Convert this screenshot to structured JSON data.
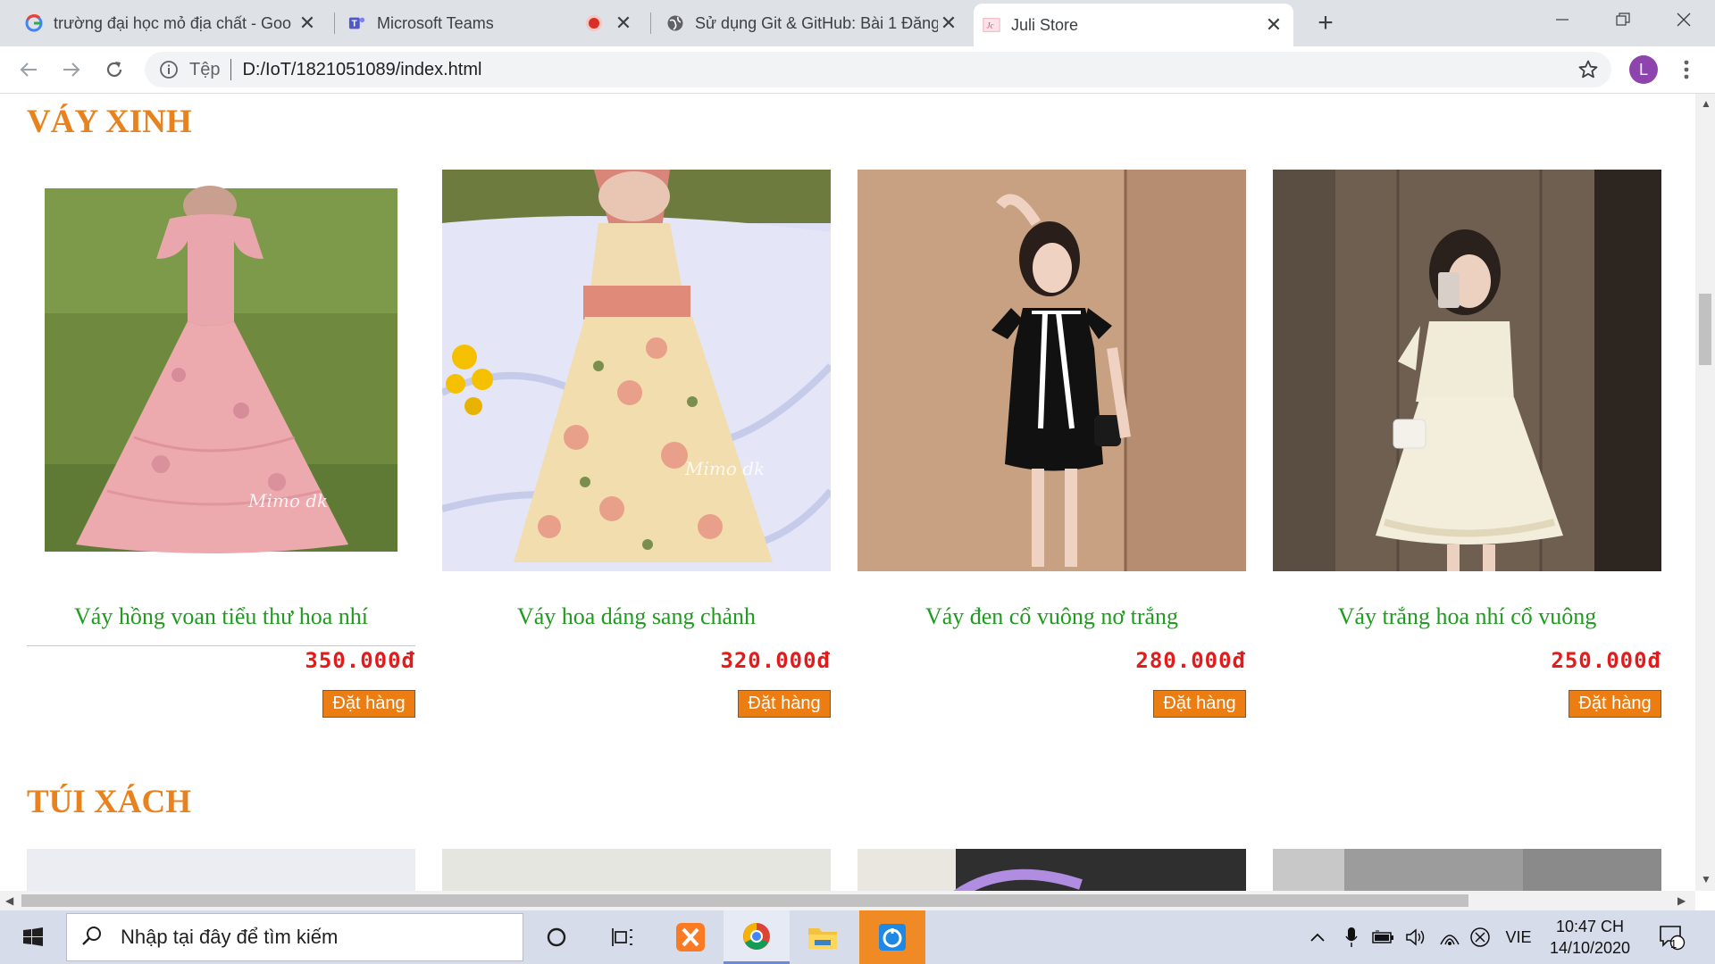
{
  "browser": {
    "tabs": [
      {
        "title": "trường đại học mỏ địa chất - Goo",
        "icon": "google-icon"
      },
      {
        "title": "Microsoft Teams",
        "icon": "teams-icon"
      },
      {
        "title": "Sử dụng Git & GitHub: Bài 1 Đăng",
        "icon": "globe-icon"
      },
      {
        "title": "Juli Store",
        "icon": "juli-store-icon"
      }
    ],
    "new_tab": "+",
    "address": {
      "scheme_label": "Tệp",
      "url": "D:/IoT/1821051089/index.html"
    },
    "profile_initial": "L"
  },
  "page": {
    "sections": [
      {
        "title": "VÁY XINH",
        "products": [
          {
            "name": "Váy hồng voan tiểu thư hoa nhí",
            "price": "350.000đ",
            "button": "Đặt hàng",
            "watermark": "Mimo dk"
          },
          {
            "name": "Váy hoa dáng sang chảnh",
            "price": "320.000đ",
            "button": "Đặt hàng",
            "watermark": "Mimo dk"
          },
          {
            "name": "Váy đen cổ vuông nơ trắng",
            "price": "280.000đ",
            "button": "Đặt hàng"
          },
          {
            "name": "Váy trắng hoa nhí cổ vuông",
            "price": "250.000đ",
            "button": "Đặt hàng"
          }
        ]
      },
      {
        "title": "TÚI XÁCH"
      }
    ]
  },
  "taskbar": {
    "search_placeholder": "Nhập tại đây để tìm kiếm",
    "language": "VIE",
    "time": "10:47 CH",
    "date": "14/10/2020",
    "notification_count": "1"
  },
  "colors": {
    "section_title": "#e8821e",
    "product_name": "#1f9b1f",
    "price": "#e31b1b",
    "order_button": "#ec7d13"
  }
}
